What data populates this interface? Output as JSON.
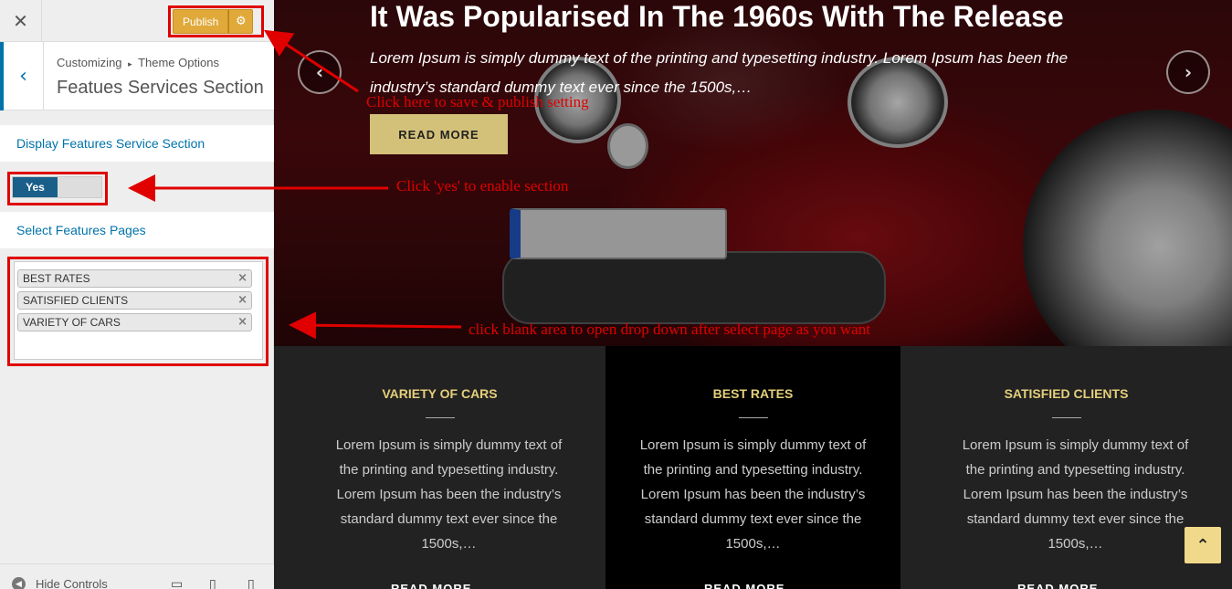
{
  "customizer": {
    "close_icon": "close-icon",
    "publish_label": "Publish",
    "breadcrumb_root": "Customizing",
    "breadcrumb_sep": "▸",
    "breadcrumb_section": "Theme Options",
    "section_title": "Featues Services Section",
    "display_label": "Display Features Service Section",
    "toggle_value": "Yes",
    "select_label": "Select Features Pages",
    "selected_pages": [
      {
        "label": "BEST RATES",
        "remove": "×"
      },
      {
        "label": "SATISFIED CLIENTS",
        "remove": "×"
      },
      {
        "label": "VARIETY OF CARS",
        "remove": "×"
      }
    ],
    "hide_controls": "Hide Controls"
  },
  "preview": {
    "hero_title": "It Was Popularised In The 1960s With The Release",
    "hero_text": "Lorem Ipsum is simply dummy text of the printing and typesetting industry. Lorem Ipsum has been the industry’s standard dummy text ever since the 1500s,…",
    "read_more": "READ MORE",
    "prev_arrow": "‹",
    "next_arrow": "›",
    "features": [
      {
        "title": "VARIETY OF CARS",
        "text": "Lorem Ipsum is simply dummy text of the printing and typesetting industry. Lorem Ipsum has been the industry’s standard dummy text ever since the 1500s,…",
        "more": "READ MORE →"
      },
      {
        "title": "BEST RATES",
        "text": "Lorem Ipsum is simply dummy text of the printing and typesetting industry. Lorem Ipsum has been the industry’s standard dummy text ever since the 1500s,…",
        "more": "READ MORE →"
      },
      {
        "title": "SATISFIED CLIENTS",
        "text": "Lorem Ipsum is simply dummy text of the printing and typesetting industry. Lorem Ipsum has been the industry’s standard dummy text ever since the 1500s,…",
        "more": "READ MORE →"
      }
    ],
    "back_to_top": "⌃"
  },
  "annotations": {
    "publish_note": "Click here to save & publish setting",
    "toggle_note": "Click 'yes' to enable section",
    "select_note": "click blank area to open drop down after select page as you want"
  },
  "colors": {
    "accent_blue": "#0073aa",
    "publish_orange": "#e0a93a",
    "gold": "#e5cf7a",
    "annotation_red": "#e00000"
  }
}
